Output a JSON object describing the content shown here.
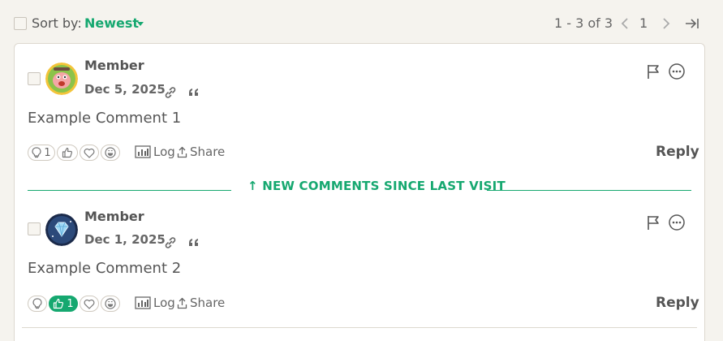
{
  "toolbar": {
    "sort_label": "Sort by:",
    "sort_value": "Newest",
    "pager_range": "1 - 3 of 3",
    "current_page": "1"
  },
  "divider": {
    "text": "↑ NEW COMMENTS SINCE LAST VISIT"
  },
  "comments": [
    {
      "author": "Member",
      "date": "Dec 5, 2025",
      "body": "Example Comment 1",
      "reactions": [
        {
          "icon": "lightbulb-icon",
          "count": "1",
          "active": false
        },
        {
          "icon": "thumbs-up-icon",
          "count": "",
          "active": false
        },
        {
          "icon": "heart-icon",
          "count": "",
          "active": false
        },
        {
          "icon": "laugh-icon",
          "count": "",
          "active": false
        }
      ],
      "log_label": "Log",
      "share_label": "Share",
      "reply_label": "Reply"
    },
    {
      "author": "Member",
      "date": "Dec 1, 2025",
      "body": "Example Comment 2",
      "reactions": [
        {
          "icon": "lightbulb-icon",
          "count": "",
          "active": false
        },
        {
          "icon": "thumbs-up-icon",
          "count": "1",
          "active": true
        },
        {
          "icon": "heart-icon",
          "count": "",
          "active": false
        },
        {
          "icon": "laugh-icon",
          "count": "",
          "active": false
        }
      ],
      "log_label": "Log",
      "share_label": "Share",
      "reply_label": "Reply"
    }
  ],
  "colors": {
    "accent": "#16a870",
    "background": "#f5f3ee",
    "panel": "#ffffff"
  }
}
